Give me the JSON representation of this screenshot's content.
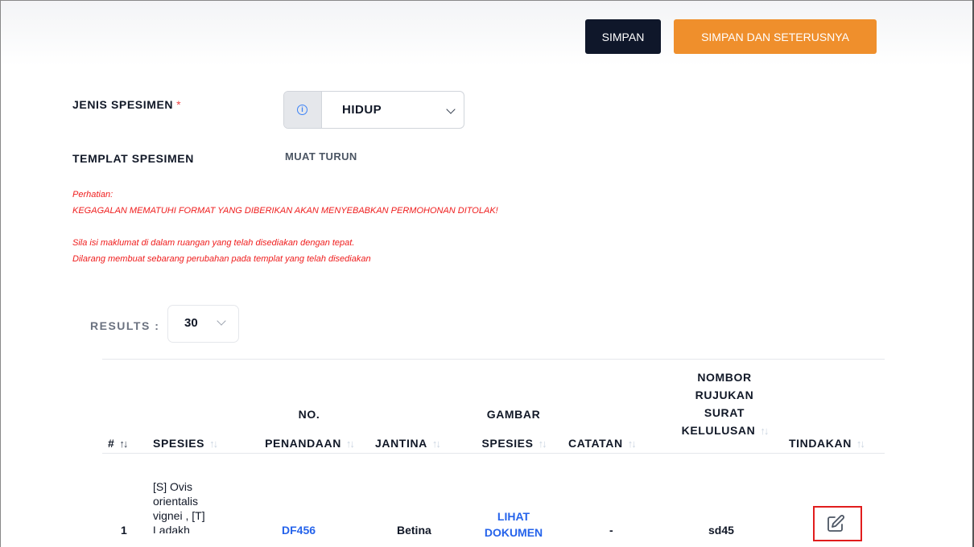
{
  "toolbar": {
    "save_label": "SIMPAN",
    "save_next_label": "SIMPAN DAN SETERUSNYA"
  },
  "form": {
    "specimen_type_label": "JENIS SPESIMEN",
    "required_mark": "*",
    "specimen_type_value": "HIDUP",
    "specimen_template_label": "TEMPLAT SPESIMEN",
    "download_label": "MUAT TURUN"
  },
  "notice": {
    "heading": "Perhatian:",
    "line1": "KEGAGALAN MEMATUHI FORMAT YANG DIBERIKAN AKAN MENYEBABKAN PERMOHONAN DITOLAK!",
    "line2": "Sila isi maklumat di dalam ruangan yang telah disediakan dengan tepat.",
    "line3": "Dilarang membuat sebarang perubahan pada templat yang telah disediakan"
  },
  "results": {
    "label": "RESULTS :",
    "value": "30"
  },
  "table": {
    "columns": {
      "no": "#",
      "species": "SPESIES",
      "tag_line1": "NO.",
      "tag_line2": "PENANDAAN",
      "gender": "JANTINA",
      "image_line1": "GAMBAR",
      "image_line2": "SPESIES",
      "notes": "CATATAN",
      "ref_line1": "NOMBOR",
      "ref_line2": "RUJUKAN",
      "ref_line3": "SURAT",
      "ref_line4": "KELULUSAN",
      "action": "TINDAKAN"
    },
    "sort_icon_active": "↑↓",
    "rows": [
      {
        "no": "1",
        "species_line1": "[S] Ovis",
        "species_line2": "orientalis",
        "species_line3": "vignei , [T]",
        "species_line4": "Ladakh",
        "tag": "DF456",
        "gender": "Betina",
        "image_line1": "LIHAT",
        "image_line2": "DOKUMEN",
        "notes": "-",
        "ref": "sd45"
      }
    ]
  },
  "icons": {
    "info": "info-icon",
    "chevron": "chevron-down-icon",
    "edit": "edit-icon"
  },
  "colors": {
    "primary_dark": "#0f172a",
    "accent_orange": "#ef8f2c",
    "warning_red": "#ef1c1c",
    "link_blue": "#2563eb"
  }
}
